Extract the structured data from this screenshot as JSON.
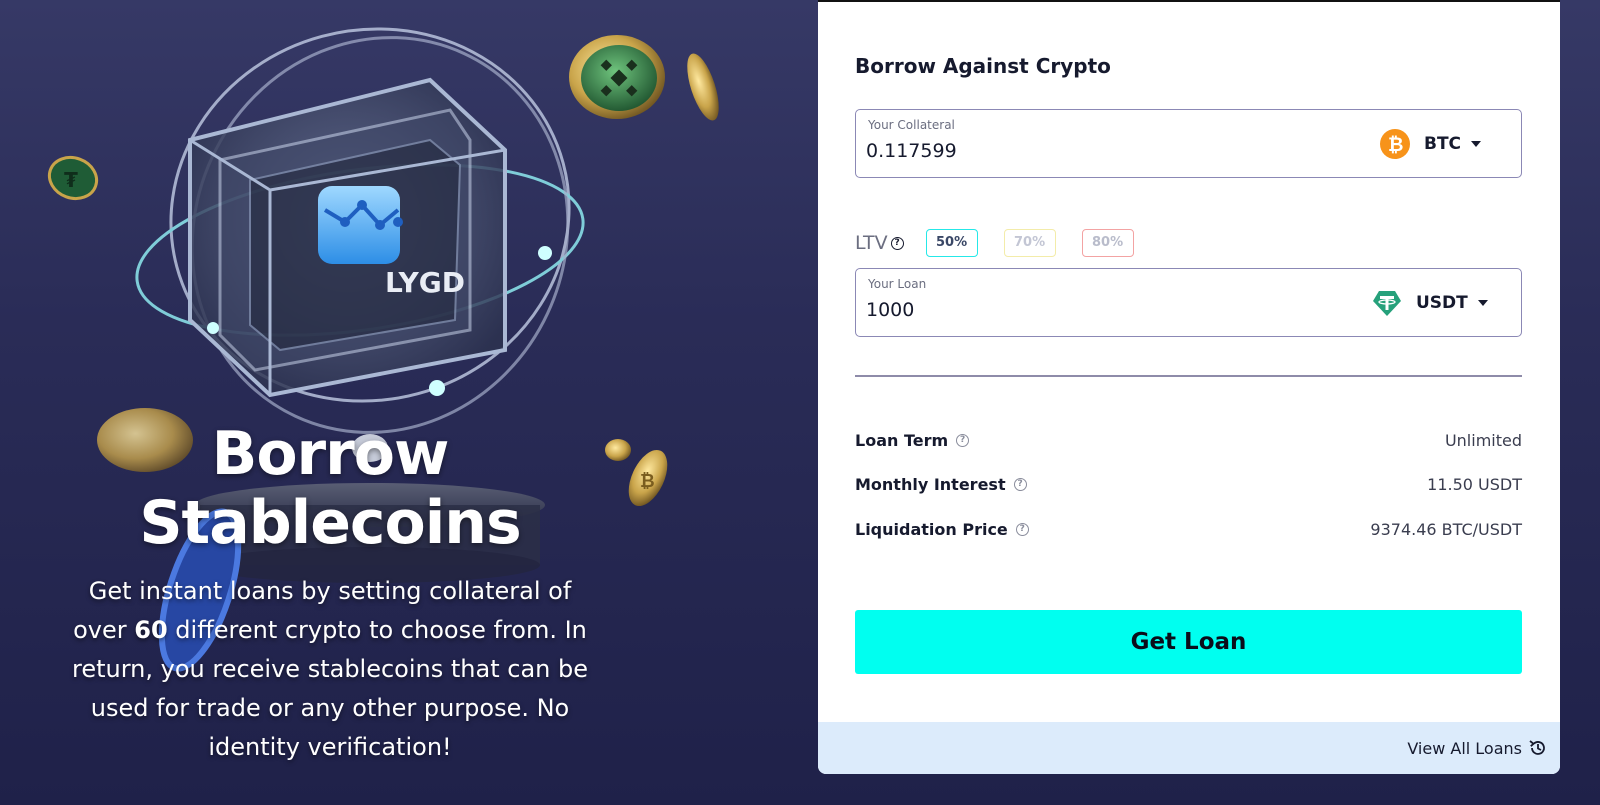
{
  "hero": {
    "title": "Borrow Stablecoins",
    "desc_before": "Get instant loans by setting collateral of over ",
    "desc_bold": "60",
    "desc_after": " different crypto to choose from. In return, you receive stablecoins that can be used for trade or any other purpose. No identity verification!",
    "logo_text": "LYGD"
  },
  "card": {
    "title": "Borrow Against Crypto",
    "collateral": {
      "label": "Your Collateral",
      "value": "0.117599",
      "coin": "BTC",
      "coin_icon": "bitcoin-icon",
      "coin_color": "#f7931a"
    },
    "ltv": {
      "label": "LTV",
      "help_icon": "question-circle-icon",
      "options": [
        "50%",
        "70%",
        "80%"
      ],
      "selected": "50%"
    },
    "loan": {
      "label": "Your Loan",
      "value": "1000",
      "coin": "USDT",
      "coin_icon": "tether-icon",
      "coin_color": "#26a17b"
    },
    "details": [
      {
        "key": "Loan Term",
        "value": "Unlimited"
      },
      {
        "key": "Monthly Interest",
        "value": "11.50 USDT"
      },
      {
        "key": "Liquidation Price",
        "value": "9374.46 BTC/USDT"
      }
    ],
    "cta": "Get Loan",
    "footer_link": "View All Loans",
    "accent_color": "#00fff0"
  }
}
